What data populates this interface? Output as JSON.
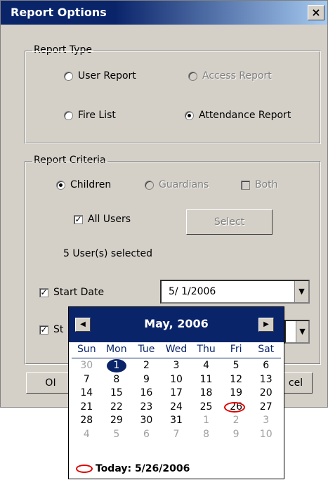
{
  "window": {
    "title": "Report Options",
    "close": "×"
  },
  "report_type": {
    "legend": "Report Type",
    "user_report": "User  Report",
    "access_report": "Access Report",
    "fire_list": "Fire List",
    "attendance_report": "Attendance Report",
    "selected": "attendance_report"
  },
  "criteria": {
    "legend": "Report Criteria",
    "children": "Children",
    "guardians": "Guardians",
    "both": "Both",
    "all_users": "All Users",
    "select_button": "Select",
    "users_selected": "5 User(s) selected",
    "start_date_label": "Start Date",
    "start_date_value": "5/ 1/2006",
    "stop_date_label": "St"
  },
  "buttons": {
    "ok": "OI",
    "cancel": "cel"
  },
  "calendar": {
    "month_title": "May, 2006",
    "weekdays": [
      "Sun",
      "Mon",
      "Tue",
      "Wed",
      "Thu",
      "Fri",
      "Sat"
    ],
    "days": [
      {
        "d": "30",
        "other": true
      },
      {
        "d": "1",
        "selected": true
      },
      {
        "d": "2"
      },
      {
        "d": "3"
      },
      {
        "d": "4"
      },
      {
        "d": "5"
      },
      {
        "d": "6"
      },
      {
        "d": "7"
      },
      {
        "d": "8"
      },
      {
        "d": "9"
      },
      {
        "d": "10"
      },
      {
        "d": "11"
      },
      {
        "d": "12"
      },
      {
        "d": "13"
      },
      {
        "d": "14"
      },
      {
        "d": "15"
      },
      {
        "d": "16"
      },
      {
        "d": "17"
      },
      {
        "d": "18"
      },
      {
        "d": "19"
      },
      {
        "d": "20"
      },
      {
        "d": "21"
      },
      {
        "d": "22"
      },
      {
        "d": "23"
      },
      {
        "d": "24"
      },
      {
        "d": "25"
      },
      {
        "d": "26",
        "today": true
      },
      {
        "d": "27"
      },
      {
        "d": "28"
      },
      {
        "d": "29"
      },
      {
        "d": "30"
      },
      {
        "d": "31"
      },
      {
        "d": "1",
        "other": true
      },
      {
        "d": "2",
        "other": true
      },
      {
        "d": "3",
        "other": true
      },
      {
        "d": "4",
        "other": true
      },
      {
        "d": "5",
        "other": true
      },
      {
        "d": "6",
        "other": true
      },
      {
        "d": "7",
        "other": true
      },
      {
        "d": "8",
        "other": true
      },
      {
        "d": "9",
        "other": true
      },
      {
        "d": "10",
        "other": true
      }
    ],
    "today_label": "Today: 5/26/2006"
  },
  "colors": {
    "title_bar": "#0a246a",
    "today_marker": "#e00000",
    "dialog_bg": "#d4d0c8"
  },
  "icons": {
    "prev": "left-triangle",
    "next": "right-triangle",
    "dropdown": "down-triangle"
  }
}
